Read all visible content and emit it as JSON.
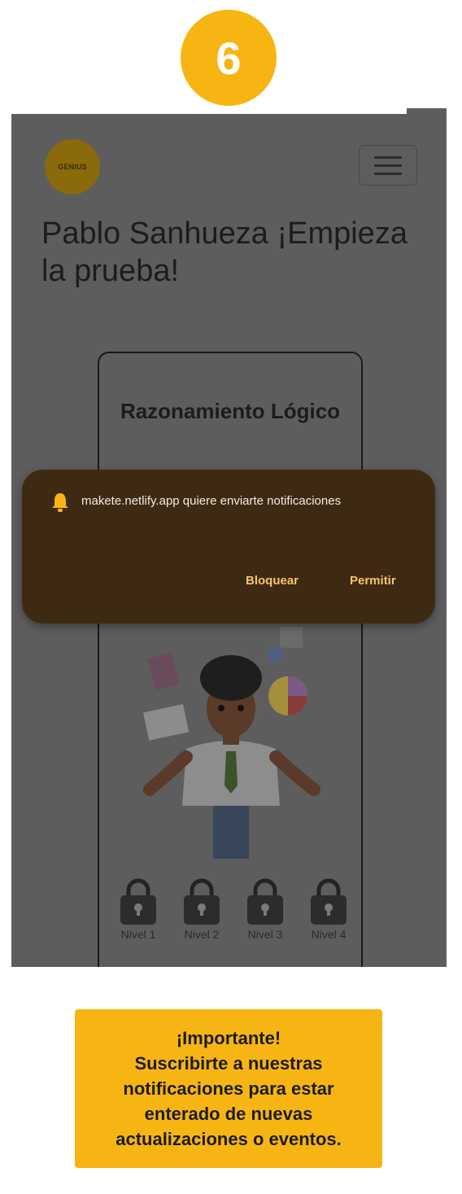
{
  "step": {
    "number": "6"
  },
  "app": {
    "logo_text": "GENIUS",
    "title": "Pablo Sanhueza ¡Empieza la prueba!",
    "menu_icon": "hamburger-menu-icon"
  },
  "card": {
    "title": "Razonamiento Lógico",
    "levels": [
      "Nivel 1",
      "Nivel 2",
      "Nivel 3",
      "Nivel 4"
    ],
    "level_icon": "lock-icon"
  },
  "notification": {
    "icon": "bell-icon",
    "message": "makete.netlify.app quiere enviarte notificaciones",
    "block_label": "Bloquear",
    "allow_label": "Permitir"
  },
  "callout": {
    "lines": [
      "¡Importante!",
      "Suscribirte a nuestras",
      "notificaciones para estar",
      "enterado de nuevas",
      "actualizaciones o eventos."
    ]
  },
  "colors": {
    "accent": "#f7b514",
    "overlay": "#5d5d5d",
    "notification_bg": "#3e2a13",
    "notification_action": "#f7c46b"
  }
}
